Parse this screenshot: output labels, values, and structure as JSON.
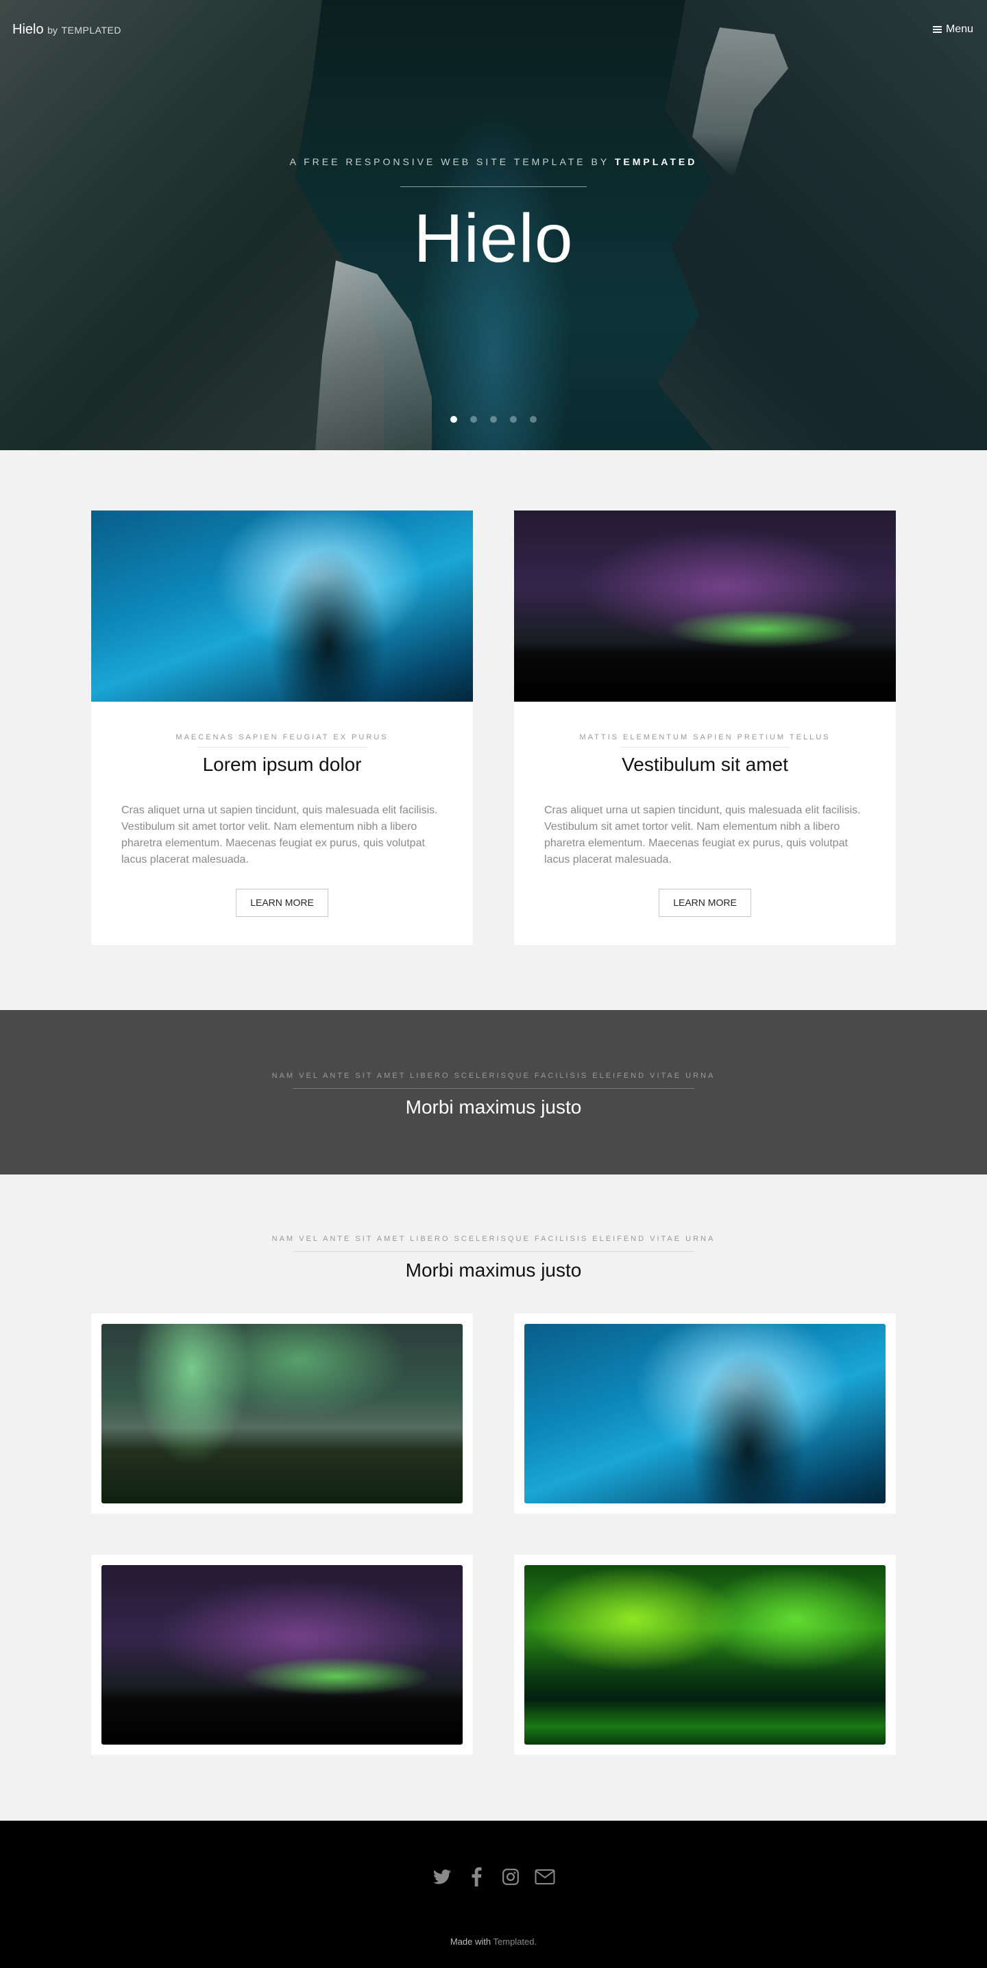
{
  "header": {
    "brand_name": "Hielo",
    "brand_by": "by",
    "brand_maker": "TEMPLATED",
    "menu_label": "Menu"
  },
  "hero": {
    "tagline_prefix": "A FREE RESPONSIVE WEB SITE TEMPLATE BY",
    "tagline_brand": "TEMPLATED",
    "title": "Hielo",
    "slides_count": 5,
    "active_slide": 1
  },
  "cards": [
    {
      "eyebrow": "MAECENAS SAPIEN FEUGIAT EX PURUS",
      "title": "Lorem ipsum dolor",
      "text": "Cras aliquet urna ut sapien tincidunt, quis malesuada elit facilisis. Vestibulum sit amet tortor velit. Nam elementum nibh a libero pharetra elementum. Maecenas feugiat ex purus, quis volutpat lacus placerat malesuada.",
      "button": "LEARN MORE"
    },
    {
      "eyebrow": "MATTIS ELEMENTUM SAPIEN PRETIUM TELLUS",
      "title": "Vestibulum sit amet",
      "text": "Cras aliquet urna ut sapien tincidunt, quis malesuada elit facilisis. Vestibulum sit amet tortor velit. Nam elementum nibh a libero pharetra elementum. Maecenas feugiat ex purus, quis volutpat lacus placerat malesuada.",
      "button": "LEARN MORE"
    }
  ],
  "band": {
    "eyebrow": "NAM VEL ANTE SIT AMET LIBERO SCELERISQUE FACILISIS ELEIFEND VITAE URNA",
    "title": "Morbi maximus justo"
  },
  "gallery": {
    "eyebrow": "NAM VEL ANTE SIT AMET LIBERO SCELERISQUE FACILISIS ELEIFEND VITAE URNA",
    "title": "Morbi maximus justo"
  },
  "footer": {
    "social_icons": [
      "twitter-icon",
      "facebook-icon",
      "instagram-icon",
      "envelope-icon"
    ],
    "made_with": "Made with",
    "made_with_link": "Templated."
  },
  "colors": {
    "band_bg": "#4a4a4a",
    "footer_bg": "#000000",
    "page_bg": "#f2f2f2"
  }
}
